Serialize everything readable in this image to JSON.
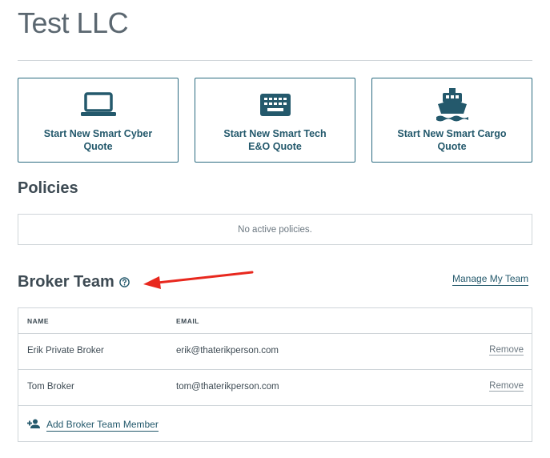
{
  "company": {
    "title": "Test LLC"
  },
  "quote_cards": [
    {
      "label": "Start New Smart Cyber Quote",
      "icon": "laptop-icon"
    },
    {
      "label": "Start New Smart Tech E&O Quote",
      "icon": "keyboard-icon"
    },
    {
      "label": "Start New Smart Cargo Quote",
      "icon": "ship-icon"
    }
  ],
  "policies": {
    "heading": "Policies",
    "empty_text": "No active policies."
  },
  "broker_team": {
    "heading": "Broker Team",
    "manage_label": "Manage My Team",
    "columns": {
      "name": "NAME",
      "email": "EMAIL"
    },
    "members": [
      {
        "name": "Erik Private Broker",
        "email": "erik@thaterikperson.com",
        "action": "Remove"
      },
      {
        "name": "Tom Broker",
        "email": "tom@thaterikperson.com",
        "action": "Remove"
      }
    ],
    "add_label": "Add Broker Team Member"
  },
  "colors": {
    "brand": "#24596c",
    "annotation_arrow": "#e8281e",
    "border": "#cfd5d9"
  }
}
